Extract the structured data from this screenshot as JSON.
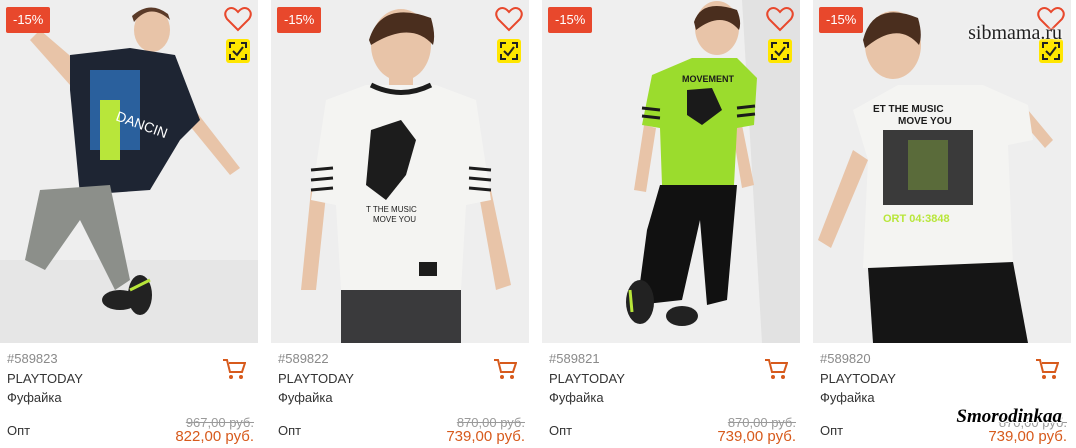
{
  "products": [
    {
      "discount": "-15%",
      "sku": "#589823",
      "brand": "PLAYTODAY",
      "type": "Фуфайка",
      "price_label": "Опт",
      "old_price": "967,00 руб.",
      "new_price": "822,00 руб.",
      "shirt_color": "#1e2533",
      "accent_color": "#b8e63a"
    },
    {
      "discount": "-15%",
      "sku": "#589822",
      "brand": "PLAYTODAY",
      "type": "Фуфайка",
      "price_label": "Опт",
      "old_price": "870,00 руб.",
      "new_price": "739,00 руб.",
      "shirt_color": "#f4f4f2",
      "accent_color": "#2a2a2a"
    },
    {
      "discount": "-15%",
      "sku": "#589821",
      "brand": "PLAYTODAY",
      "type": "Фуфайка",
      "price_label": "Опт",
      "old_price": "870,00 руб.",
      "new_price": "739,00 руб.",
      "shirt_color": "#9bdc2d",
      "accent_color": "#1a1a1a"
    },
    {
      "discount": "-15%",
      "sku": "#589820",
      "brand": "PLAYTODAY",
      "type": "Фуфайка",
      "price_label": "Опт",
      "old_price": "870,00 руб.",
      "new_price": "739,00 руб.",
      "shirt_color": "#f4f4f2",
      "accent_color": "#b8e63a"
    }
  ],
  "watermarks": {
    "top": "sibmama.ru",
    "bottom": "Smorodinkaa"
  },
  "icons": {
    "favorite": "heart-outline-icon",
    "fast_order": "check-frame-icon",
    "cart": "cart-icon"
  },
  "colors": {
    "discount_bg": "#e8482c",
    "price": "#d75a1c",
    "fast_badge": "#ffe600"
  }
}
